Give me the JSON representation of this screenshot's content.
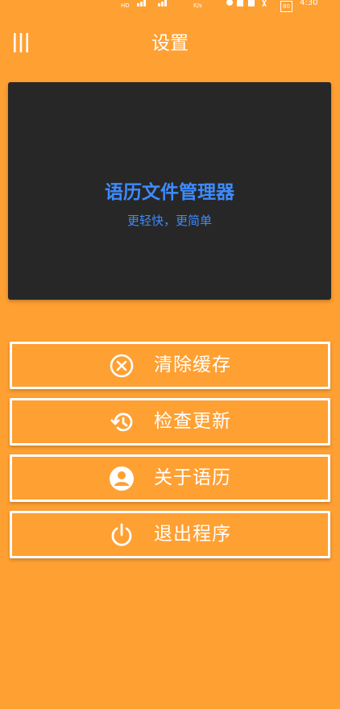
{
  "status_bar": {
    "network_speed": "K/s",
    "time": "4:30",
    "battery": "80"
  },
  "header": {
    "title": "设置",
    "menu_icon": "menu-icon"
  },
  "banner": {
    "title": "语历文件管理器",
    "subtitle": "更轻快，更简单",
    "background": "#272727",
    "text_color": "#3D8BFF"
  },
  "actions": [
    {
      "label": "清除缓存",
      "icon": "clear-cache-icon"
    },
    {
      "label": "检查更新",
      "icon": "history-icon"
    },
    {
      "label": "关于语历",
      "icon": "account-icon"
    },
    {
      "label": "退出程序",
      "icon": "power-icon"
    }
  ],
  "colors": {
    "background": "#FFA033",
    "foreground": "#FFFFFF"
  }
}
